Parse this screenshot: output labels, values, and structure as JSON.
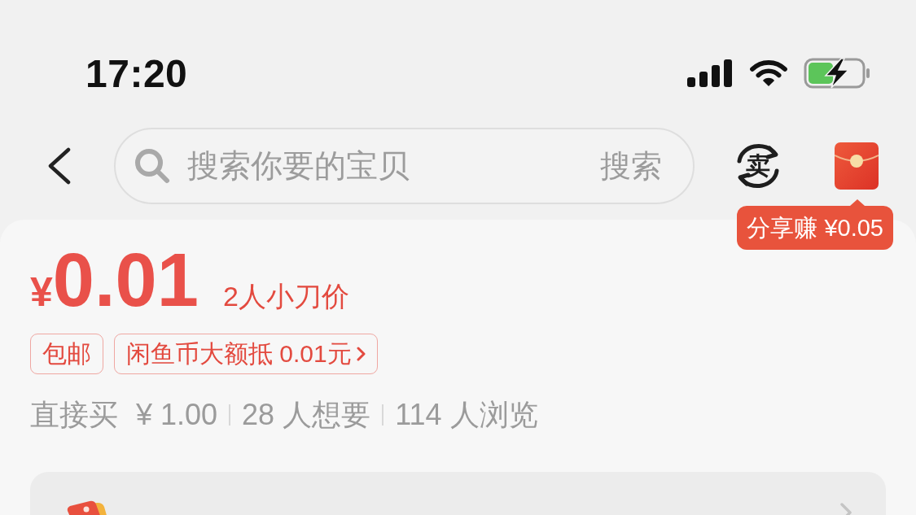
{
  "status_bar": {
    "time": "17:20"
  },
  "search": {
    "placeholder": "搜索你要的宝贝",
    "button": "搜索"
  },
  "sell_button": {
    "label": "卖"
  },
  "share_tip": {
    "label": "分享赚 ¥0.05"
  },
  "price": {
    "currency": "¥",
    "amount": "0.01",
    "note": "2人小刀价"
  },
  "tags": [
    {
      "label": "包邮",
      "kind": "plain"
    },
    {
      "label": "闲鱼币大额抵 0.01元",
      "kind": "link"
    }
  ],
  "stats": {
    "buy_label": "直接买",
    "buy_price": "¥ 1.00",
    "counts": [
      "28 人想要",
      "114 人浏览"
    ]
  }
}
